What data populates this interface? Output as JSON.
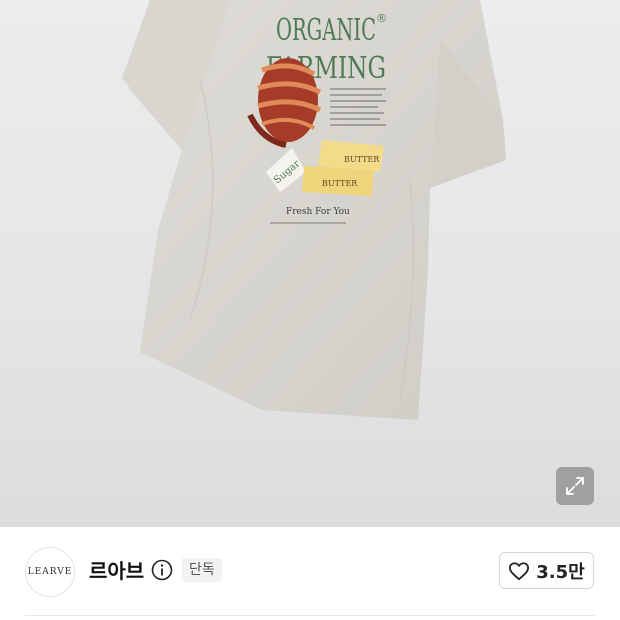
{
  "product_image": {
    "print_title_line1": "ORGANIC",
    "print_title_line2": "FARMING",
    "print_registered": "®",
    "print_sugar_label": "Sugar",
    "print_butter_label_1": "BUTTER",
    "print_butter_label_2": "BUTTER",
    "print_tagline": "Fresh For You",
    "colors": {
      "shirt": "#d9d8d2",
      "print_green": "#4f7a55",
      "croissant": "#b5452e",
      "butter": "#f2dc8a"
    }
  },
  "expand_button": {
    "icon": "expand-arrows-icon"
  },
  "brand": {
    "logo_text": "LEARVE",
    "name": "르아브",
    "info_icon": "info-icon",
    "badge": "단독"
  },
  "like": {
    "icon": "heart-outline-icon",
    "count": "3.5만"
  }
}
